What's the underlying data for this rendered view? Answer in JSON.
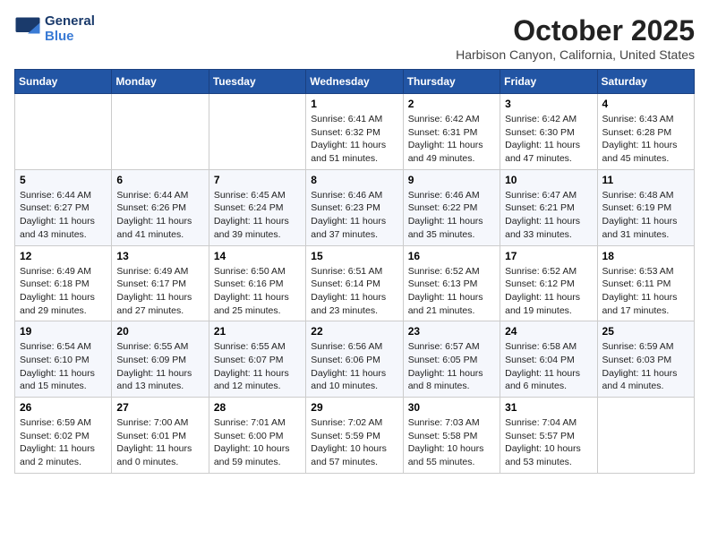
{
  "header": {
    "logo_line1": "General",
    "logo_line2": "Blue",
    "month": "October 2025",
    "location": "Harbison Canyon, California, United States"
  },
  "weekdays": [
    "Sunday",
    "Monday",
    "Tuesday",
    "Wednesday",
    "Thursday",
    "Friday",
    "Saturday"
  ],
  "weeks": [
    [
      {
        "day": "",
        "sunrise": "",
        "sunset": "",
        "daylight": ""
      },
      {
        "day": "",
        "sunrise": "",
        "sunset": "",
        "daylight": ""
      },
      {
        "day": "",
        "sunrise": "",
        "sunset": "",
        "daylight": ""
      },
      {
        "day": "1",
        "sunrise": "Sunrise: 6:41 AM",
        "sunset": "Sunset: 6:32 PM",
        "daylight": "Daylight: 11 hours and 51 minutes."
      },
      {
        "day": "2",
        "sunrise": "Sunrise: 6:42 AM",
        "sunset": "Sunset: 6:31 PM",
        "daylight": "Daylight: 11 hours and 49 minutes."
      },
      {
        "day": "3",
        "sunrise": "Sunrise: 6:42 AM",
        "sunset": "Sunset: 6:30 PM",
        "daylight": "Daylight: 11 hours and 47 minutes."
      },
      {
        "day": "4",
        "sunrise": "Sunrise: 6:43 AM",
        "sunset": "Sunset: 6:28 PM",
        "daylight": "Daylight: 11 hours and 45 minutes."
      }
    ],
    [
      {
        "day": "5",
        "sunrise": "Sunrise: 6:44 AM",
        "sunset": "Sunset: 6:27 PM",
        "daylight": "Daylight: 11 hours and 43 minutes."
      },
      {
        "day": "6",
        "sunrise": "Sunrise: 6:44 AM",
        "sunset": "Sunset: 6:26 PM",
        "daylight": "Daylight: 11 hours and 41 minutes."
      },
      {
        "day": "7",
        "sunrise": "Sunrise: 6:45 AM",
        "sunset": "Sunset: 6:24 PM",
        "daylight": "Daylight: 11 hours and 39 minutes."
      },
      {
        "day": "8",
        "sunrise": "Sunrise: 6:46 AM",
        "sunset": "Sunset: 6:23 PM",
        "daylight": "Daylight: 11 hours and 37 minutes."
      },
      {
        "day": "9",
        "sunrise": "Sunrise: 6:46 AM",
        "sunset": "Sunset: 6:22 PM",
        "daylight": "Daylight: 11 hours and 35 minutes."
      },
      {
        "day": "10",
        "sunrise": "Sunrise: 6:47 AM",
        "sunset": "Sunset: 6:21 PM",
        "daylight": "Daylight: 11 hours and 33 minutes."
      },
      {
        "day": "11",
        "sunrise": "Sunrise: 6:48 AM",
        "sunset": "Sunset: 6:19 PM",
        "daylight": "Daylight: 11 hours and 31 minutes."
      }
    ],
    [
      {
        "day": "12",
        "sunrise": "Sunrise: 6:49 AM",
        "sunset": "Sunset: 6:18 PM",
        "daylight": "Daylight: 11 hours and 29 minutes."
      },
      {
        "day": "13",
        "sunrise": "Sunrise: 6:49 AM",
        "sunset": "Sunset: 6:17 PM",
        "daylight": "Daylight: 11 hours and 27 minutes."
      },
      {
        "day": "14",
        "sunrise": "Sunrise: 6:50 AM",
        "sunset": "Sunset: 6:16 PM",
        "daylight": "Daylight: 11 hours and 25 minutes."
      },
      {
        "day": "15",
        "sunrise": "Sunrise: 6:51 AM",
        "sunset": "Sunset: 6:14 PM",
        "daylight": "Daylight: 11 hours and 23 minutes."
      },
      {
        "day": "16",
        "sunrise": "Sunrise: 6:52 AM",
        "sunset": "Sunset: 6:13 PM",
        "daylight": "Daylight: 11 hours and 21 minutes."
      },
      {
        "day": "17",
        "sunrise": "Sunrise: 6:52 AM",
        "sunset": "Sunset: 6:12 PM",
        "daylight": "Daylight: 11 hours and 19 minutes."
      },
      {
        "day": "18",
        "sunrise": "Sunrise: 6:53 AM",
        "sunset": "Sunset: 6:11 PM",
        "daylight": "Daylight: 11 hours and 17 minutes."
      }
    ],
    [
      {
        "day": "19",
        "sunrise": "Sunrise: 6:54 AM",
        "sunset": "Sunset: 6:10 PM",
        "daylight": "Daylight: 11 hours and 15 minutes."
      },
      {
        "day": "20",
        "sunrise": "Sunrise: 6:55 AM",
        "sunset": "Sunset: 6:09 PM",
        "daylight": "Daylight: 11 hours and 13 minutes."
      },
      {
        "day": "21",
        "sunrise": "Sunrise: 6:55 AM",
        "sunset": "Sunset: 6:07 PM",
        "daylight": "Daylight: 11 hours and 12 minutes."
      },
      {
        "day": "22",
        "sunrise": "Sunrise: 6:56 AM",
        "sunset": "Sunset: 6:06 PM",
        "daylight": "Daylight: 11 hours and 10 minutes."
      },
      {
        "day": "23",
        "sunrise": "Sunrise: 6:57 AM",
        "sunset": "Sunset: 6:05 PM",
        "daylight": "Daylight: 11 hours and 8 minutes."
      },
      {
        "day": "24",
        "sunrise": "Sunrise: 6:58 AM",
        "sunset": "Sunset: 6:04 PM",
        "daylight": "Daylight: 11 hours and 6 minutes."
      },
      {
        "day": "25",
        "sunrise": "Sunrise: 6:59 AM",
        "sunset": "Sunset: 6:03 PM",
        "daylight": "Daylight: 11 hours and 4 minutes."
      }
    ],
    [
      {
        "day": "26",
        "sunrise": "Sunrise: 6:59 AM",
        "sunset": "Sunset: 6:02 PM",
        "daylight": "Daylight: 11 hours and 2 minutes."
      },
      {
        "day": "27",
        "sunrise": "Sunrise: 7:00 AM",
        "sunset": "Sunset: 6:01 PM",
        "daylight": "Daylight: 11 hours and 0 minutes."
      },
      {
        "day": "28",
        "sunrise": "Sunrise: 7:01 AM",
        "sunset": "Sunset: 6:00 PM",
        "daylight": "Daylight: 10 hours and 59 minutes."
      },
      {
        "day": "29",
        "sunrise": "Sunrise: 7:02 AM",
        "sunset": "Sunset: 5:59 PM",
        "daylight": "Daylight: 10 hours and 57 minutes."
      },
      {
        "day": "30",
        "sunrise": "Sunrise: 7:03 AM",
        "sunset": "Sunset: 5:58 PM",
        "daylight": "Daylight: 10 hours and 55 minutes."
      },
      {
        "day": "31",
        "sunrise": "Sunrise: 7:04 AM",
        "sunset": "Sunset: 5:57 PM",
        "daylight": "Daylight: 10 hours and 53 minutes."
      },
      {
        "day": "",
        "sunrise": "",
        "sunset": "",
        "daylight": ""
      }
    ]
  ]
}
